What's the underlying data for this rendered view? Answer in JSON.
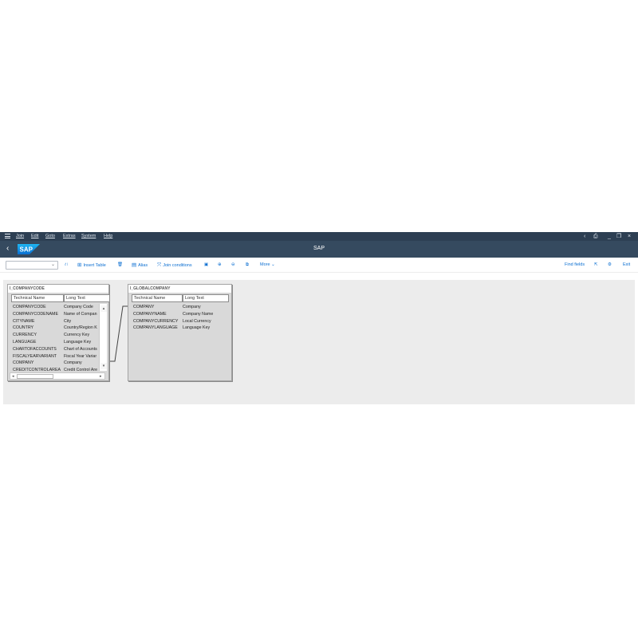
{
  "menubar": {
    "items": [
      "Join",
      "Edit",
      "Goto",
      "Extras",
      "System",
      "Help"
    ]
  },
  "titlebar": {
    "title": "SAP",
    "logo_text": "SAP",
    "brand_color": "#0a6ed1"
  },
  "toolbar": {
    "combo_value": "",
    "insert_table": "Insert Table",
    "alias": "Alias",
    "join_conditions": "Join conditions",
    "more": "More",
    "find_fields": "Find fields",
    "exit": "Exit"
  },
  "tables": {
    "left": {
      "name": "I_COMPANYCODE",
      "col1": "Technical Name",
      "col2": "Long Text",
      "rows": [
        {
          "tech": "COMPANYCODE",
          "text": "Company Code"
        },
        {
          "tech": "COMPANYCODENAME",
          "text": "Name of Compan"
        },
        {
          "tech": "CITYNAME",
          "text": "City"
        },
        {
          "tech": "COUNTRY",
          "text": "Country/Region K"
        },
        {
          "tech": "CURRENCY",
          "text": "Currency Key"
        },
        {
          "tech": "LANGUAGE",
          "text": "Language Key"
        },
        {
          "tech": "CHARTOFACCOUNTS",
          "text": "Chart of Accounts"
        },
        {
          "tech": "FISCALYEARVARIANT",
          "text": "Fiscal Year Variar"
        },
        {
          "tech": "COMPANY",
          "text": "Company"
        },
        {
          "tech": "CREDITCONTROLAREA",
          "text": "Credit Control Are"
        }
      ]
    },
    "right": {
      "name": "I_GLOBALCOMPANY",
      "col1": "Technical Name",
      "col2": "Long Text",
      "rows": [
        {
          "tech": "COMPANY",
          "text": "Company"
        },
        {
          "tech": "COMPANYNAME",
          "text": "Company Name"
        },
        {
          "tech": "COMPANYCURRENCY",
          "text": "Local Currency"
        },
        {
          "tech": "COMPANYLANGUAGE",
          "text": "Language Key"
        }
      ]
    }
  }
}
